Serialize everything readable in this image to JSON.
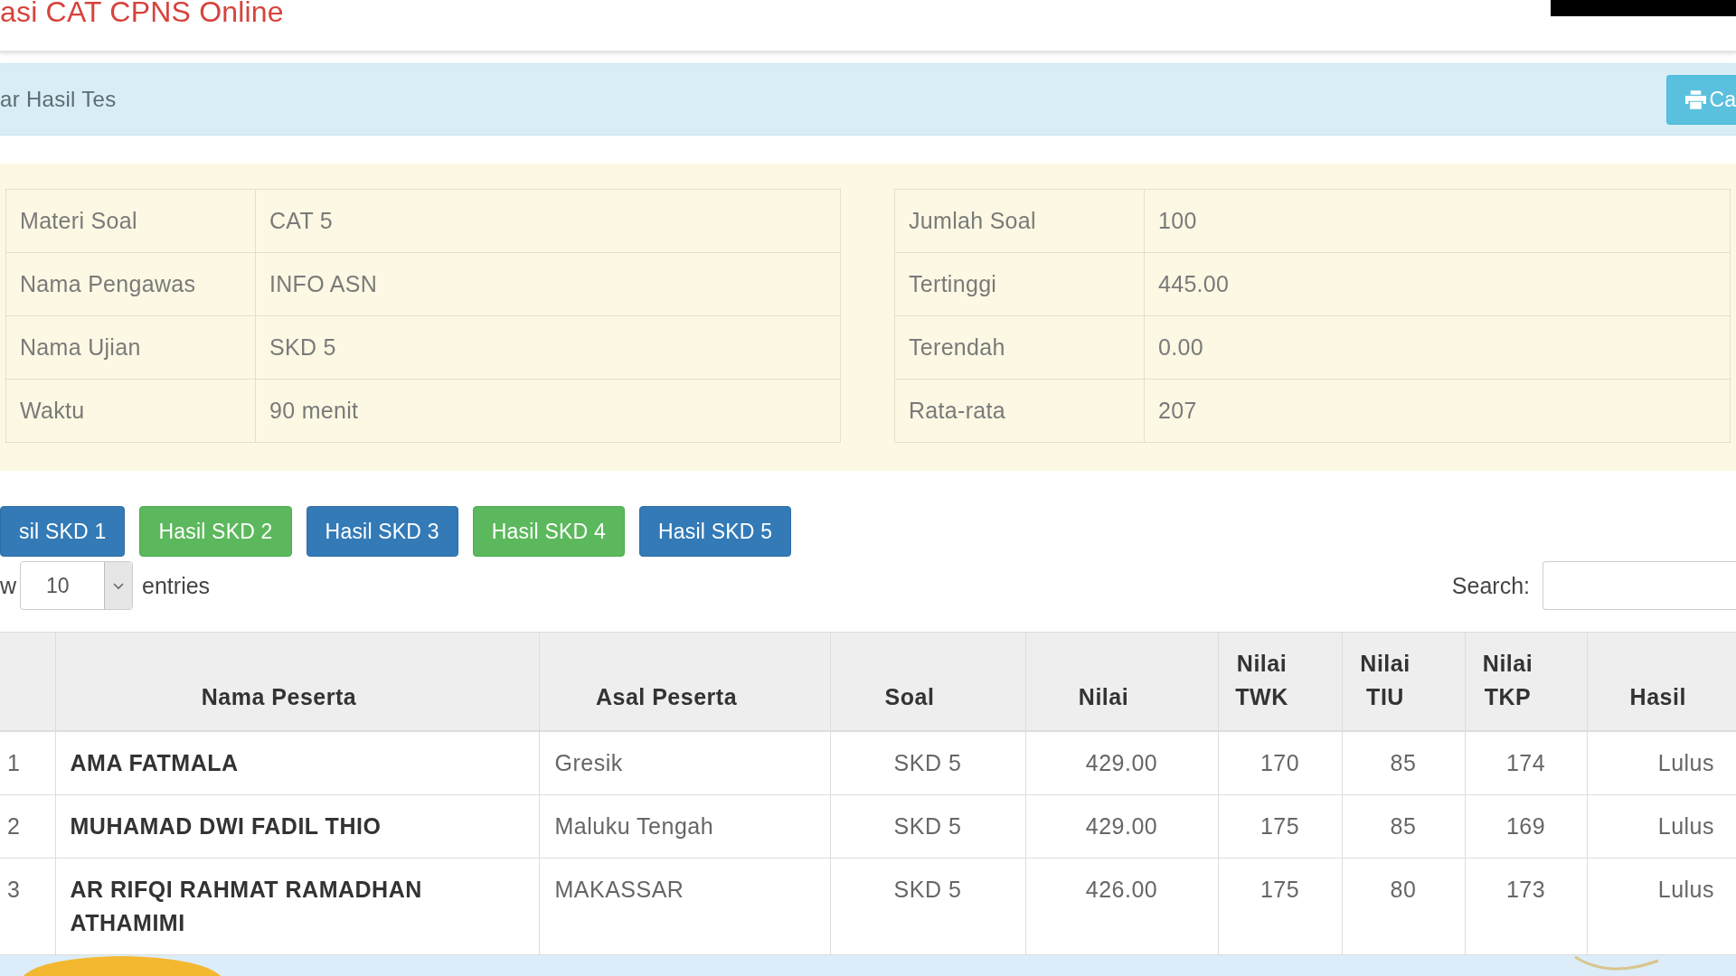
{
  "navbar": {
    "title": "asi CAT CPNS Online"
  },
  "panel": {
    "title": "ar Hasil Tes",
    "print_button": "Ca"
  },
  "summary": {
    "left": [
      {
        "label": "Materi Soal",
        "value": "CAT 5"
      },
      {
        "label": "Nama Pengawas",
        "value": "INFO ASN"
      },
      {
        "label": "Nama Ujian",
        "value": "SKD 5"
      },
      {
        "label": "Waktu",
        "value": "90 menit"
      }
    ],
    "right": [
      {
        "label": "Jumlah Soal",
        "value": "100"
      },
      {
        "label": "Tertinggi",
        "value": "445.00"
      },
      {
        "label": "Terendah",
        "value": "0.00"
      },
      {
        "label": "Rata-rata",
        "value": "207"
      }
    ]
  },
  "result_buttons": [
    {
      "label": "sil SKD 1",
      "kind": "primary"
    },
    {
      "label": "Hasil SKD 2",
      "kind": "success"
    },
    {
      "label": "Hasil SKD 3",
      "kind": "primary"
    },
    {
      "label": "Hasil SKD 4",
      "kind": "success"
    },
    {
      "label": "Hasil SKD 5",
      "kind": "primary"
    }
  ],
  "length_menu": {
    "prefix": "w",
    "value": "10",
    "suffix": "entries"
  },
  "search": {
    "label": "Search:"
  },
  "table": {
    "columns": [
      "Nama Peserta",
      "Asal Peserta",
      "Soal",
      "Nilai",
      "Nilai TWK",
      "Nilai TIU",
      "Nilai TKP",
      "Hasil"
    ],
    "rows": [
      {
        "number": "1",
        "cells": [
          "AMA FATMALA",
          "Gresik",
          "SKD 5",
          "429.00",
          "170",
          "85",
          "174",
          "Lulus"
        ]
      },
      {
        "number": "2",
        "cells": [
          "MUHAMAD DWI FADIL THIO",
          "Maluku Tengah",
          "SKD 5",
          "429.00",
          "175",
          "85",
          "169",
          "Lulus"
        ]
      },
      {
        "number": "3",
        "cells": [
          "AR RIFQI RAHMAT RAMADHAN ATHAMIMI",
          "MAKASSAR",
          "SKD 5",
          "426.00",
          "175",
          "80",
          "173",
          "Lulus"
        ]
      }
    ]
  }
}
